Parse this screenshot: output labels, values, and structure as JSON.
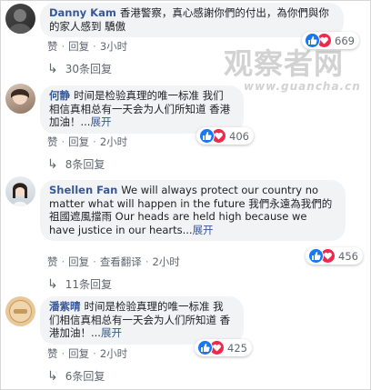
{
  "watermark": {
    "main": "观察者网",
    "url": "www.guancha.cn"
  },
  "comments": [
    {
      "author": "Danny Kam",
      "text": "香港警察，真心感謝你們的付出，為你們與你的家人感到 驕傲",
      "more": "",
      "actions": [
        "赞",
        "回复",
        "3小时"
      ],
      "reactions": "669",
      "replies": "30条回复"
    },
    {
      "author": "何静",
      "text": "时间是检验真理的唯一标准 我们相信真相总有一天会为人们所知道 香港加油！...",
      "more": "展开",
      "actions": [
        "赞",
        "回复",
        "2小时"
      ],
      "reactions": "406",
      "replies": "8条回复"
    },
    {
      "author": "Shellen Fan",
      "text": "We will always protect our country no matter what will happen in the future 我們永遠為我們的祖國遮風擋雨 Our heads are held high because we have justice in our hearts...",
      "more": "展开",
      "actions": [
        "赞",
        "回复",
        "查看翻译",
        "2小时"
      ],
      "reactions": "456",
      "replies": "11条回复"
    },
    {
      "author": "潘紫晴",
      "text": "时间是检验真理的唯一标准 我们相信真相总有一天会为人们所知道 香港加油！...",
      "more": "展开",
      "actions": [
        "赞",
        "回复",
        "2小时"
      ],
      "reactions": "425",
      "replies": "6条回复"
    }
  ],
  "colors": {
    "link": "#385898",
    "bubble": "#f2f3f5",
    "like": "#1877f2",
    "love": "#f0284a",
    "muted": "#606770"
  },
  "icons": [
    "like-reaction-icon",
    "love-reaction-icon",
    "reply-arrow-icon"
  ]
}
